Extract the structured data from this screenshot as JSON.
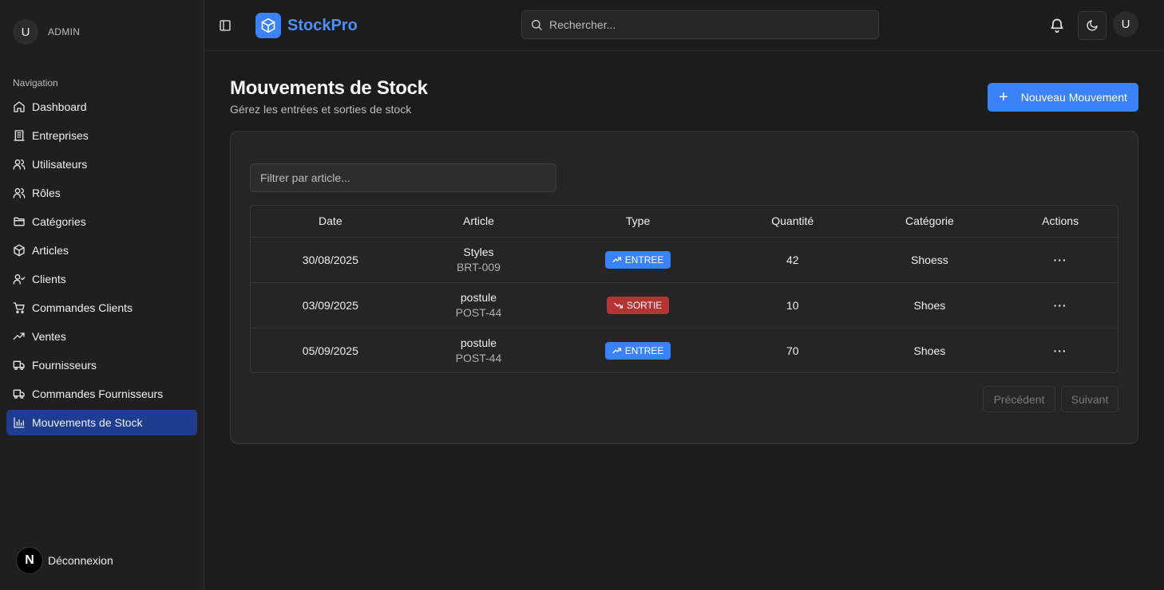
{
  "sidebar": {
    "user_initial": "U",
    "user_role": "ADMIN",
    "nav_label": "Navigation",
    "items": [
      {
        "label": "Dashboard",
        "icon": "home-icon"
      },
      {
        "label": "Entreprises",
        "icon": "building-icon"
      },
      {
        "label": "Utilisateurs",
        "icon": "users-icon"
      },
      {
        "label": "Rôles",
        "icon": "users-icon"
      },
      {
        "label": "Catégories",
        "icon": "folder-icon"
      },
      {
        "label": "Articles",
        "icon": "box-icon"
      },
      {
        "label": "Clients",
        "icon": "user-check-icon"
      },
      {
        "label": "Commandes Clients",
        "icon": "cart-icon"
      },
      {
        "label": "Ventes",
        "icon": "trending-up-icon"
      },
      {
        "label": "Fournisseurs",
        "icon": "truck-icon"
      },
      {
        "label": "Commandes Fournisseurs",
        "icon": "truck-icon"
      },
      {
        "label": "Mouvements de Stock",
        "icon": "bar-chart-icon",
        "active": true
      }
    ],
    "logout_badge": "N",
    "logout_label": "Déconnexion"
  },
  "header": {
    "brand": "StockPro",
    "search_placeholder": "Rechercher...",
    "avatar_initial": "U",
    "accent": "#3b82f6"
  },
  "main": {
    "title": "Mouvements de Stock",
    "subtitle": "Gérez les entrées et sorties de stock",
    "new_button": "Nouveau Mouvement",
    "filter_placeholder": "Filtrer par article...",
    "columns": [
      "Date",
      "Article",
      "Type",
      "Quantité",
      "Catégorie",
      "Actions"
    ],
    "rows": [
      {
        "date": "30/08/2025",
        "article": "Styles",
        "code": "BRT-009",
        "type": "ENTREE",
        "type_kind": "in",
        "qty": "42",
        "category": "Shoess",
        "actions": "···"
      },
      {
        "date": "03/09/2025",
        "article": "postule",
        "code": "POST-44",
        "type": "SORTIE",
        "type_kind": "out",
        "qty": "10",
        "category": "Shoes",
        "actions": "···"
      },
      {
        "date": "05/09/2025",
        "article": "postule",
        "code": "POST-44",
        "type": "ENTREE",
        "type_kind": "in",
        "qty": "70",
        "category": "Shoes",
        "actions": "···"
      }
    ],
    "prev_label": "Précédent",
    "next_label": "Suivant"
  }
}
